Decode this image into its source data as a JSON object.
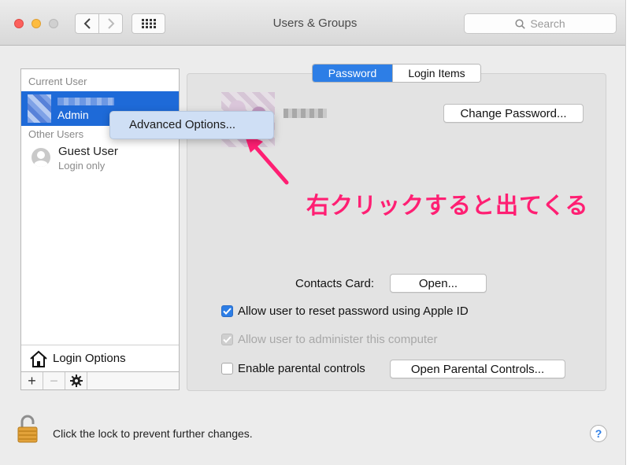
{
  "window": {
    "title": "Users & Groups",
    "search_placeholder": "Search"
  },
  "sidebar": {
    "current_user_label": "Current User",
    "selected_user_role": "Admin",
    "other_users_label": "Other Users",
    "guest": {
      "name": "Guest User",
      "subtitle": "Login only"
    },
    "login_options_label": "Login Options",
    "toolbar": {
      "add": "+",
      "remove": "−"
    }
  },
  "context_menu": {
    "item": "Advanced Options..."
  },
  "tabs": [
    {
      "label": "Password",
      "active": true
    },
    {
      "label": "Login Items",
      "active": false
    }
  ],
  "password_pane": {
    "change_password_label": "Change Password...",
    "contacts_card_label": "Contacts Card:",
    "open_label": "Open...",
    "allow_reset_label": "Allow user to reset password using Apple ID",
    "allow_reset_checked": true,
    "allow_admin_label": "Allow user to administer this computer",
    "allow_admin_checked": true,
    "parental_label": "Enable parental controls",
    "parental_checked": false,
    "open_parental_label": "Open Parental Controls..."
  },
  "annotation": {
    "text": "右クリックすると出てくる",
    "color": "#ff1f73"
  },
  "footer": {
    "lock_text": "Click the lock to prevent further changes.",
    "help_label": "?"
  },
  "colors": {
    "accent": "#2d7ee6",
    "selection": "#1e6ad8"
  }
}
